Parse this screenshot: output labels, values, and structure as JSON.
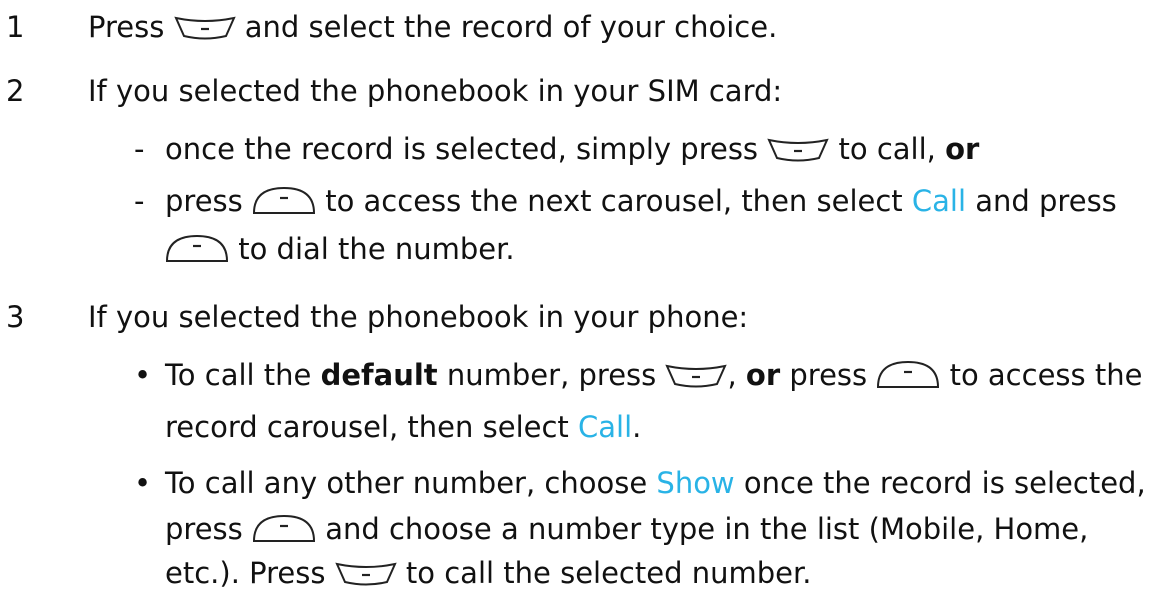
{
  "colors": {
    "text": "#111111",
    "keyword": "#29b3e6",
    "key_stroke": "#222222"
  },
  "icons": {
    "call_key": "call-key-icon",
    "menu_key": "menu-ok-key-icon"
  },
  "steps": [
    {
      "num": "1",
      "l1_a": "Press",
      "l1_b": "and select the record of your choice."
    },
    {
      "num": "2",
      "l1": "If you selected the phonebook in your SIM card:",
      "sub1": {
        "marker": "-",
        "a": "once the record is selected, simply press",
        "b": "to call,",
        "bold": "or"
      },
      "sub2": {
        "marker": "-",
        "a": "press",
        "b": "to access the next carousel, then select",
        "kw": "Call",
        "c": "and press",
        "d": "to dial the number."
      }
    },
    {
      "num": "3",
      "l1": "If you selected the phonebook in your phone:",
      "bullet1": {
        "marker": "•",
        "a": "To call the",
        "bold1": "default",
        "b": "number, press",
        "c": ",",
        "bold2": "or",
        "d": "press",
        "e": "to access the",
        "f": "record carousel, then select",
        "kw": "Call",
        "g": "."
      },
      "bullet2": {
        "marker": "•",
        "a": "To call any other number, choose",
        "kw": "Show",
        "b": "once the record is selected,",
        "c": "press",
        "d": "and choose a number type in the list (Mobile, Home,",
        "e": "etc.). Press",
        "f": "to call the selected number."
      }
    }
  ]
}
